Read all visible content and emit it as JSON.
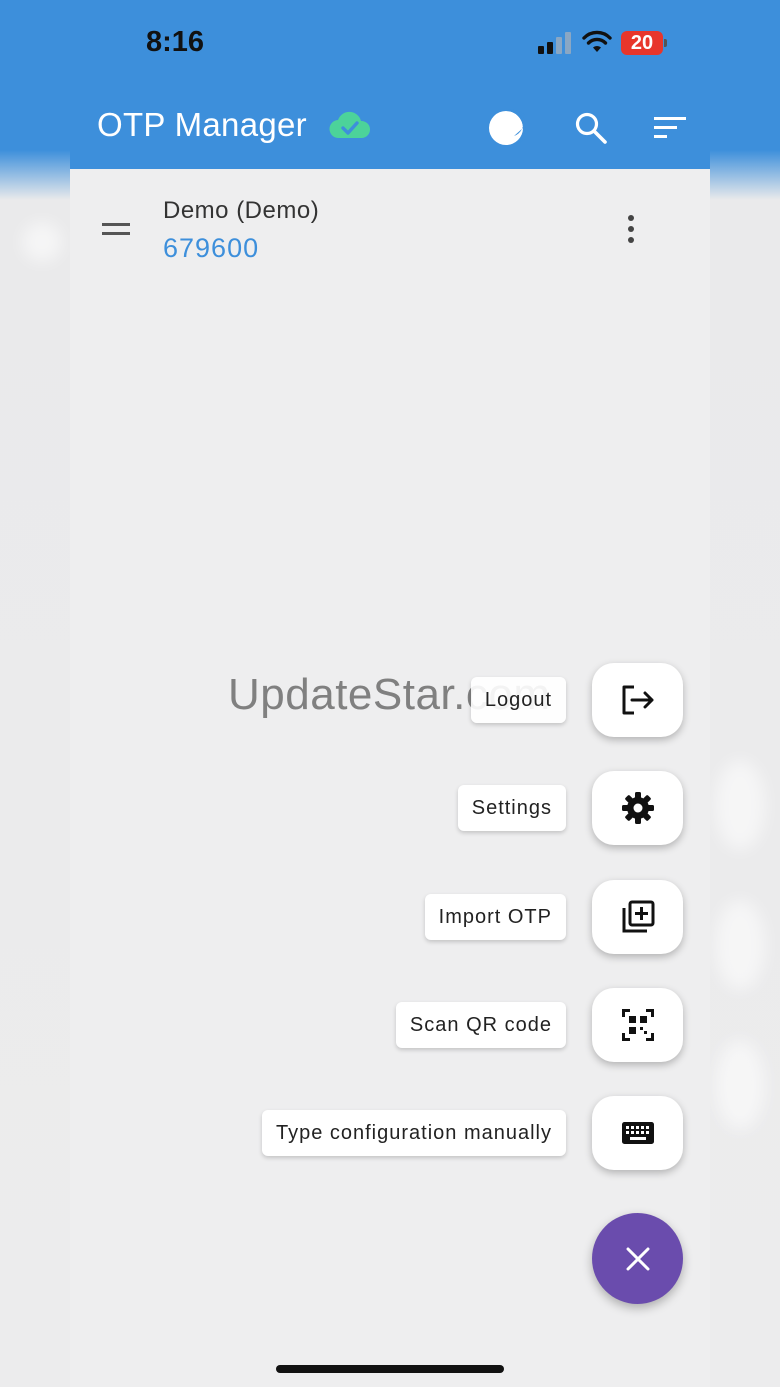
{
  "status_bar": {
    "time": "8:16",
    "battery": "20"
  },
  "app_bar": {
    "title": "OTP Manager",
    "icons": [
      "cloud-check-icon",
      "theme-toggle-icon",
      "search-icon",
      "sort-icon"
    ],
    "colors": {
      "primary": "#3d8fdb",
      "sync_ok": "#4cd39a"
    }
  },
  "otp_list": [
    {
      "title": "Demo (Demo)",
      "code": "679600"
    }
  ],
  "speed_dial": {
    "actions": [
      {
        "label": "Logout",
        "icon": "logout-icon"
      },
      {
        "label": "Settings",
        "icon": "gear-icon"
      },
      {
        "label": "Import OTP",
        "icon": "library-add-icon"
      },
      {
        "label": "Scan QR code",
        "icon": "qr-code-scanner-icon"
      },
      {
        "label": "Type configuration manually",
        "icon": "keyboard-icon"
      }
    ],
    "main_icon": "close-icon",
    "main_color": "#6a4cad"
  },
  "watermark": "UpdateStar.com"
}
